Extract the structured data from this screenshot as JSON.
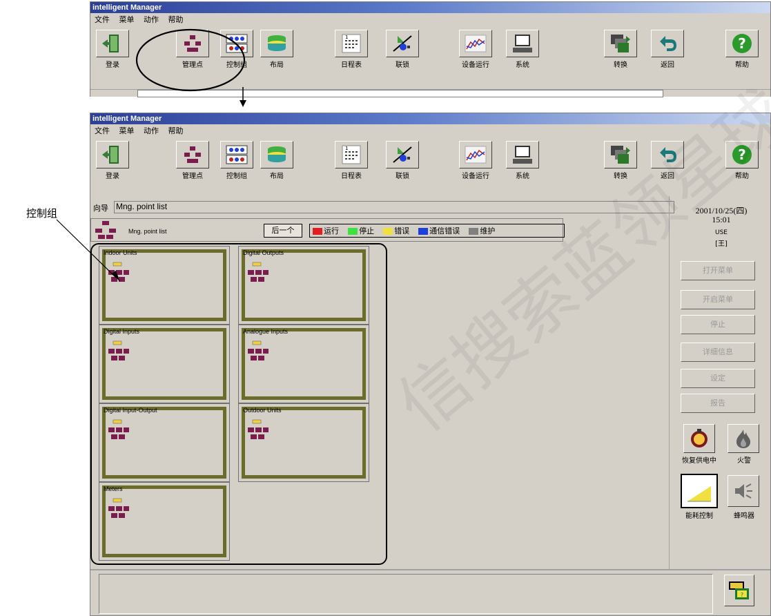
{
  "app_title": "intelligent Manager",
  "menu": [
    "文件",
    "菜单",
    "动作",
    "帮助"
  ],
  "toolbar": [
    {
      "label": "登录",
      "icon": "login-door-icon"
    },
    {
      "label": "管理点",
      "icon": "management-point-icon"
    },
    {
      "label": "控制组",
      "icon": "control-group-icon"
    },
    {
      "label": "布局",
      "icon": "layout-icon"
    },
    {
      "label": "日程表",
      "icon": "schedule-icon"
    },
    {
      "label": "联锁",
      "icon": "interlock-icon"
    },
    {
      "label": "设备运行",
      "icon": "equipment-run-icon"
    },
    {
      "label": "系统",
      "icon": "system-icon"
    },
    {
      "label": "转换",
      "icon": "switch-icon"
    },
    {
      "label": "返回",
      "icon": "back-icon"
    },
    {
      "label": "帮助",
      "icon": "help-icon"
    }
  ],
  "nav": {
    "label": "向导",
    "path": "Mng. point list"
  },
  "datetime": {
    "date": "2001/10/25(四)",
    "time": "15:01"
  },
  "user": {
    "label": "USE",
    "value": "[王]"
  },
  "list_header": {
    "title": "Mng. point list",
    "next_button": "后一个"
  },
  "legend": [
    {
      "label": "运行",
      "color": "#e02020"
    },
    {
      "label": "停止",
      "color": "#40e040"
    },
    {
      "label": "错误",
      "color": "#f0e040"
    },
    {
      "label": "通信错误",
      "color": "#1f3fd8"
    },
    {
      "label": "维护",
      "color": "#808080"
    }
  ],
  "tiles": [
    {
      "name": "Indoor Units"
    },
    {
      "name": "Digital Outputs"
    },
    {
      "name": "Digital Inputs"
    },
    {
      "name": "Analogue Inputs"
    },
    {
      "name": "Digital Input-Output"
    },
    {
      "name": "Outdoor Units"
    },
    {
      "name": "Meters"
    }
  ],
  "side_buttons": [
    "打开菜单",
    "开启菜单",
    "停止",
    "详细信息",
    "设定",
    "报告"
  ],
  "side_icons": [
    {
      "label": "恢复供电中",
      "icon": "power-restore-icon"
    },
    {
      "label": "火警",
      "icon": "fire-alarm-icon"
    },
    {
      "label": "能耗控制",
      "icon": "energy-control-icon"
    },
    {
      "label": "蜂鸣器",
      "icon": "buzzer-icon"
    }
  ],
  "annotation": {
    "label": "控制组"
  },
  "watermark": "信搜索蓝领星球"
}
